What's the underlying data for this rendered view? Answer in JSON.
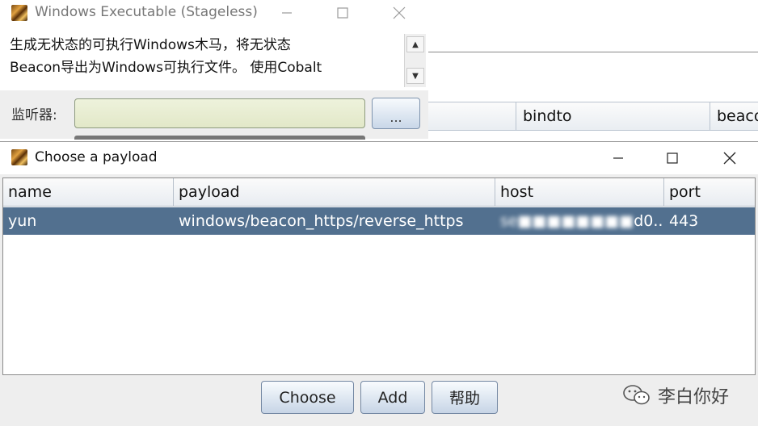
{
  "bg_window": {
    "title": "Windows Executable (Stageless)",
    "description_lines": [
      "生成无状态的可执行Windows木马，将无状态",
      "Beacon导出为Windows可执行文件。 使用Cobalt"
    ],
    "listener_label": "监听器:",
    "browse_label": "..."
  },
  "bg_table": {
    "columns": [
      "bindto",
      "beaco"
    ]
  },
  "dialog": {
    "title": "Choose a payload",
    "columns": {
      "name": "name",
      "payload": "payload",
      "host": "host",
      "port": "port"
    },
    "rows": [
      {
        "name": "yun",
        "payload": "windows/beacon_https/reverse_https",
        "host_blurred": "se■■■■■■■■",
        "host_tail": "d0...",
        "port": "443"
      }
    ],
    "buttons": {
      "choose": "Choose",
      "add": "Add",
      "help": "帮助"
    }
  },
  "watermark": {
    "text": "李白你好",
    "icon": "wechat-icon"
  },
  "colors": {
    "selection": "#52708f",
    "button_gradient_bottom": "#c7d5e6"
  }
}
